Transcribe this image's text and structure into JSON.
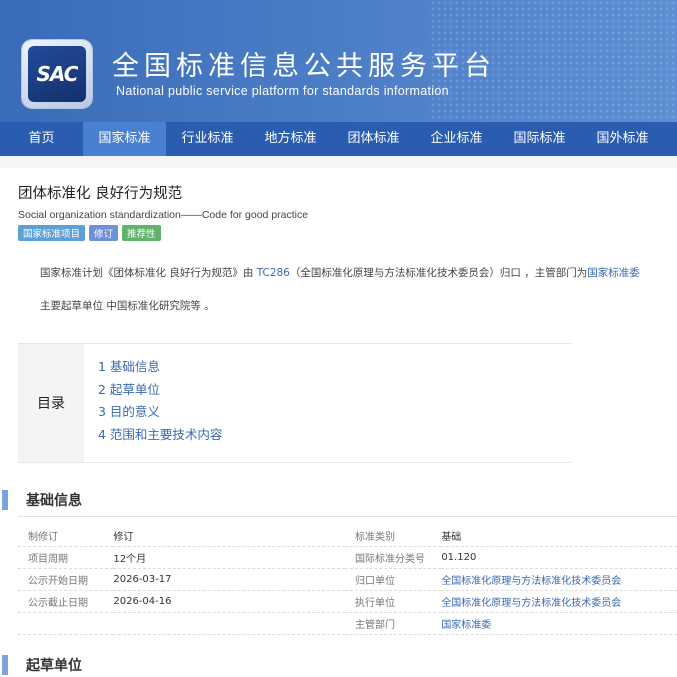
{
  "header": {
    "logo_text": "SAC",
    "title_cn": "全国标准信息公共服务平台",
    "title_en": "National public service platform  for standards information"
  },
  "nav": {
    "items": [
      "首页",
      "国家标准",
      "行业标准",
      "地方标准",
      "团体标准",
      "企业标准",
      "国际标准",
      "国外标准"
    ],
    "active": "国家标准"
  },
  "standard": {
    "title": "团体标准化 良好行为规范",
    "title_en": "Social organization standardization——Code for good practice",
    "badges": [
      {
        "label": "国家标准项目",
        "color": "#5da0d8"
      },
      {
        "label": "修订",
        "color": "#6f8fd6"
      },
      {
        "label": "推荐性",
        "color": "#5fb36a"
      }
    ]
  },
  "intro": {
    "p1_a": "国家标准计划《团体标准化 良好行为规范》由 ",
    "p1_link": "TC286",
    "p1_b": "（全国标准化原理与方法标准化技术委员会）归口 ，主管部门为",
    "p1_link2": "国家标准委",
    "p2": "主要起草单位 中国标准化研究院等 。"
  },
  "toc": {
    "label": "目录",
    "items": [
      "1  基础信息",
      "2  起草单位",
      "3  目的意义",
      "4  范围和主要技术内容"
    ]
  },
  "sections": {
    "basic": "基础信息",
    "drafters": "起草单位"
  },
  "basic_info": {
    "rows": [
      {
        "k1": "制修订",
        "v1": "修订",
        "k2": "标准类别",
        "v2": "基础",
        "v2_link": false
      },
      {
        "k1": "项目周期",
        "v1": "12个月",
        "k2": "国际标准分类号",
        "v2": "01.120",
        "v2_link": false
      },
      {
        "k1": "公示开始日期",
        "v1": "2026-03-17",
        "k2": "归口单位",
        "v2": "全国标准化原理与方法标准化技术委员会",
        "v2_link": true
      },
      {
        "k1": "公示截止日期",
        "v1": "2026-04-16",
        "k2": "执行单位",
        "v2": "全国标准化原理与方法标准化技术委员会",
        "v2_link": true
      },
      {
        "k1": "",
        "v1": "",
        "k2": "主管部门",
        "v2": "国家标准委",
        "v2_link": true
      }
    ]
  }
}
